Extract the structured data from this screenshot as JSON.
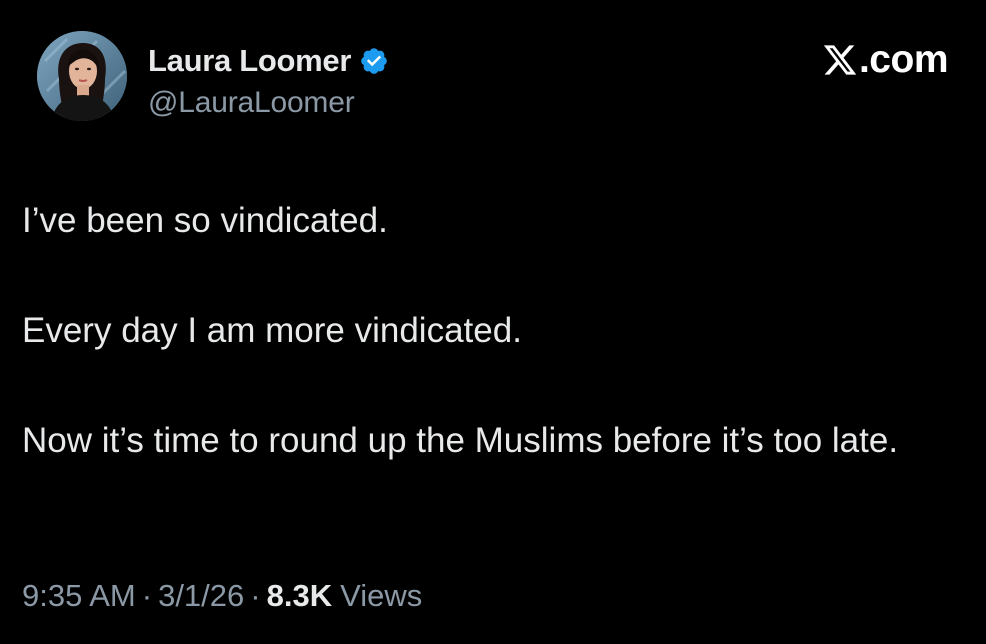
{
  "author": {
    "display_name": "Laura Loomer",
    "handle": "@LauraLoomer",
    "verified": true,
    "verified_color": "#1d9bf0",
    "avatar": "avatar-photo"
  },
  "brand": {
    "text": ".com",
    "icon": "x-logo-icon"
  },
  "tweet": {
    "paragraphs": [
      "I’ve been so vindicated.",
      "Every day I am more vindicated.",
      "Now it’s time to round up the Muslims before it’s too late."
    ]
  },
  "meta": {
    "time": "9:35 AM",
    "separator": "·",
    "date": "3/1/26",
    "views_count": "8.3K",
    "views_label": "Views"
  },
  "colors": {
    "background": "#000000",
    "primary_text": "#e7e9ea",
    "secondary_text": "#8b98a5",
    "accent": "#1d9bf0"
  }
}
